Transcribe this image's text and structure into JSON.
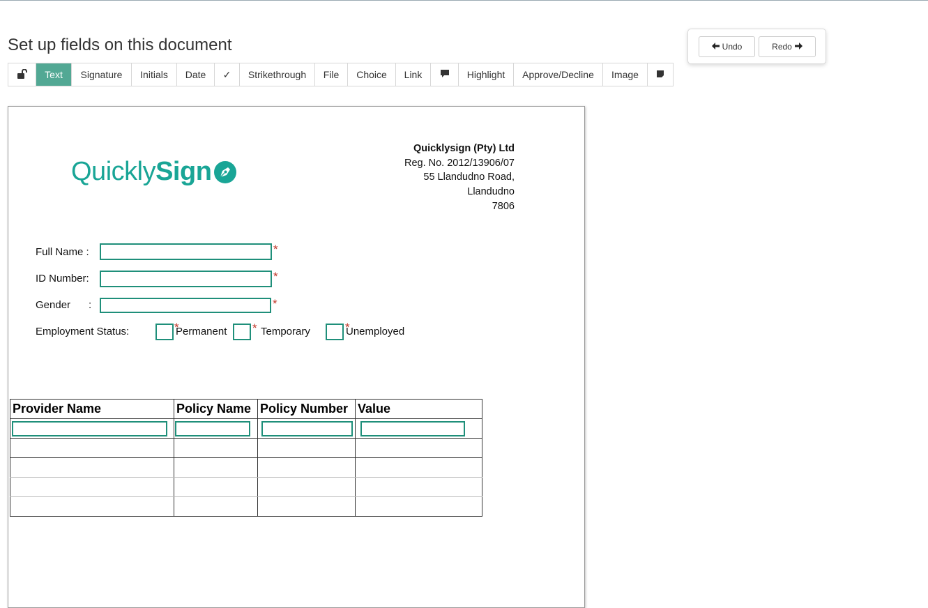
{
  "page": {
    "title": "Set up fields on this document"
  },
  "toolbar": {
    "items": [
      {
        "label": "",
        "icon": "unlock-icon",
        "width": 40
      },
      {
        "label": "Text",
        "active": true
      },
      {
        "label": "Signature"
      },
      {
        "label": "Initials"
      },
      {
        "label": "Date"
      },
      {
        "label": "✓"
      },
      {
        "label": "Strikethrough"
      },
      {
        "label": "File"
      },
      {
        "label": "Choice"
      },
      {
        "label": "Link"
      },
      {
        "label": "",
        "icon": "comment-icon"
      },
      {
        "label": "Highlight"
      },
      {
        "label": "Approve/Decline"
      },
      {
        "label": "Image"
      },
      {
        "label": "",
        "icon": "sticky-note-icon"
      }
    ]
  },
  "history": {
    "undo_label": "Undo",
    "redo_label": "Redo"
  },
  "document": {
    "logo": {
      "light": "Quickly",
      "bold": "Sign",
      "color": "#19a596"
    },
    "company": {
      "name": "Quicklysign (Pty) Ltd",
      "reg": "Reg. No. 2012/13906/07",
      "street": "55 Llandudno Road,",
      "city": "Llandudno",
      "postcode": "7806"
    },
    "fields": {
      "full_name_label": "Full Name :",
      "id_label": "ID Number:",
      "gender_label": "Gender",
      "gender_colon": ":",
      "employment_label": "Employment Status:",
      "opt_permanent": "Permanent",
      "opt_temporary": "Temporary",
      "opt_unemployed": "Unemployed",
      "required_marker": "*"
    },
    "table": {
      "headers": [
        "Provider Name",
        "Policy Name",
        "Policy Number",
        "Value"
      ]
    }
  },
  "colors": {
    "accent": "#52a894",
    "field_border": "#1f8f7a",
    "required": "#c0392b"
  }
}
